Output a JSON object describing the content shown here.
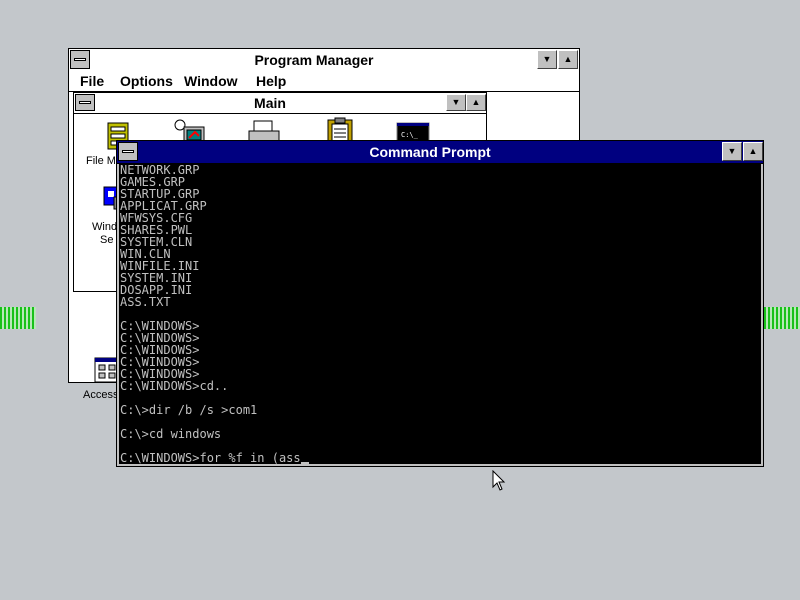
{
  "program_manager": {
    "title": "Program Manager",
    "menu": [
      "File",
      "Options",
      "Window",
      "Help"
    ],
    "main_group": {
      "title": "Main",
      "icons": [
        {
          "label": "File Ma",
          "icon": "file-manager-icon"
        },
        {
          "label": "",
          "icon": "control-panel-icon"
        },
        {
          "label": "",
          "icon": "print-manager-icon"
        },
        {
          "label": "",
          "icon": "clipboard-viewer-icon"
        },
        {
          "label": "",
          "icon": "ms-dos-prompt-icon"
        },
        {
          "label": "Wind",
          "label2": "Se",
          "icon": "windows-setup-icon"
        }
      ]
    },
    "accessories_label": "Access",
    "accessories_icon": "accessories-group-icon"
  },
  "command_prompt": {
    "title": "Command Prompt",
    "lines": [
      "NETWORK.GRP",
      "GAMES.GRP",
      "STARTUP.GRP",
      "APPLICAT.GRP",
      "WFWSYS.CFG",
      "SHARES.PWL",
      "SYSTEM.CLN",
      "WIN.CLN",
      "WINFILE.INI",
      "SYSTEM.INI",
      "DOSAPP.INI",
      "ASS.TXT",
      "",
      "C:\\WINDOWS>",
      "C:\\WINDOWS>",
      "C:\\WINDOWS>",
      "C:\\WINDOWS>",
      "C:\\WINDOWS>",
      "C:\\WINDOWS>cd..",
      "",
      "C:\\>dir /b /s >com1",
      "",
      "C:\\>cd windows",
      "",
      "C:\\WINDOWS>for %f in (ass"
    ]
  },
  "colors": {
    "desktop": "#c3c7cb",
    "active_title": "#000080",
    "console_bg": "#000000",
    "console_text": "#c0c0c0"
  }
}
